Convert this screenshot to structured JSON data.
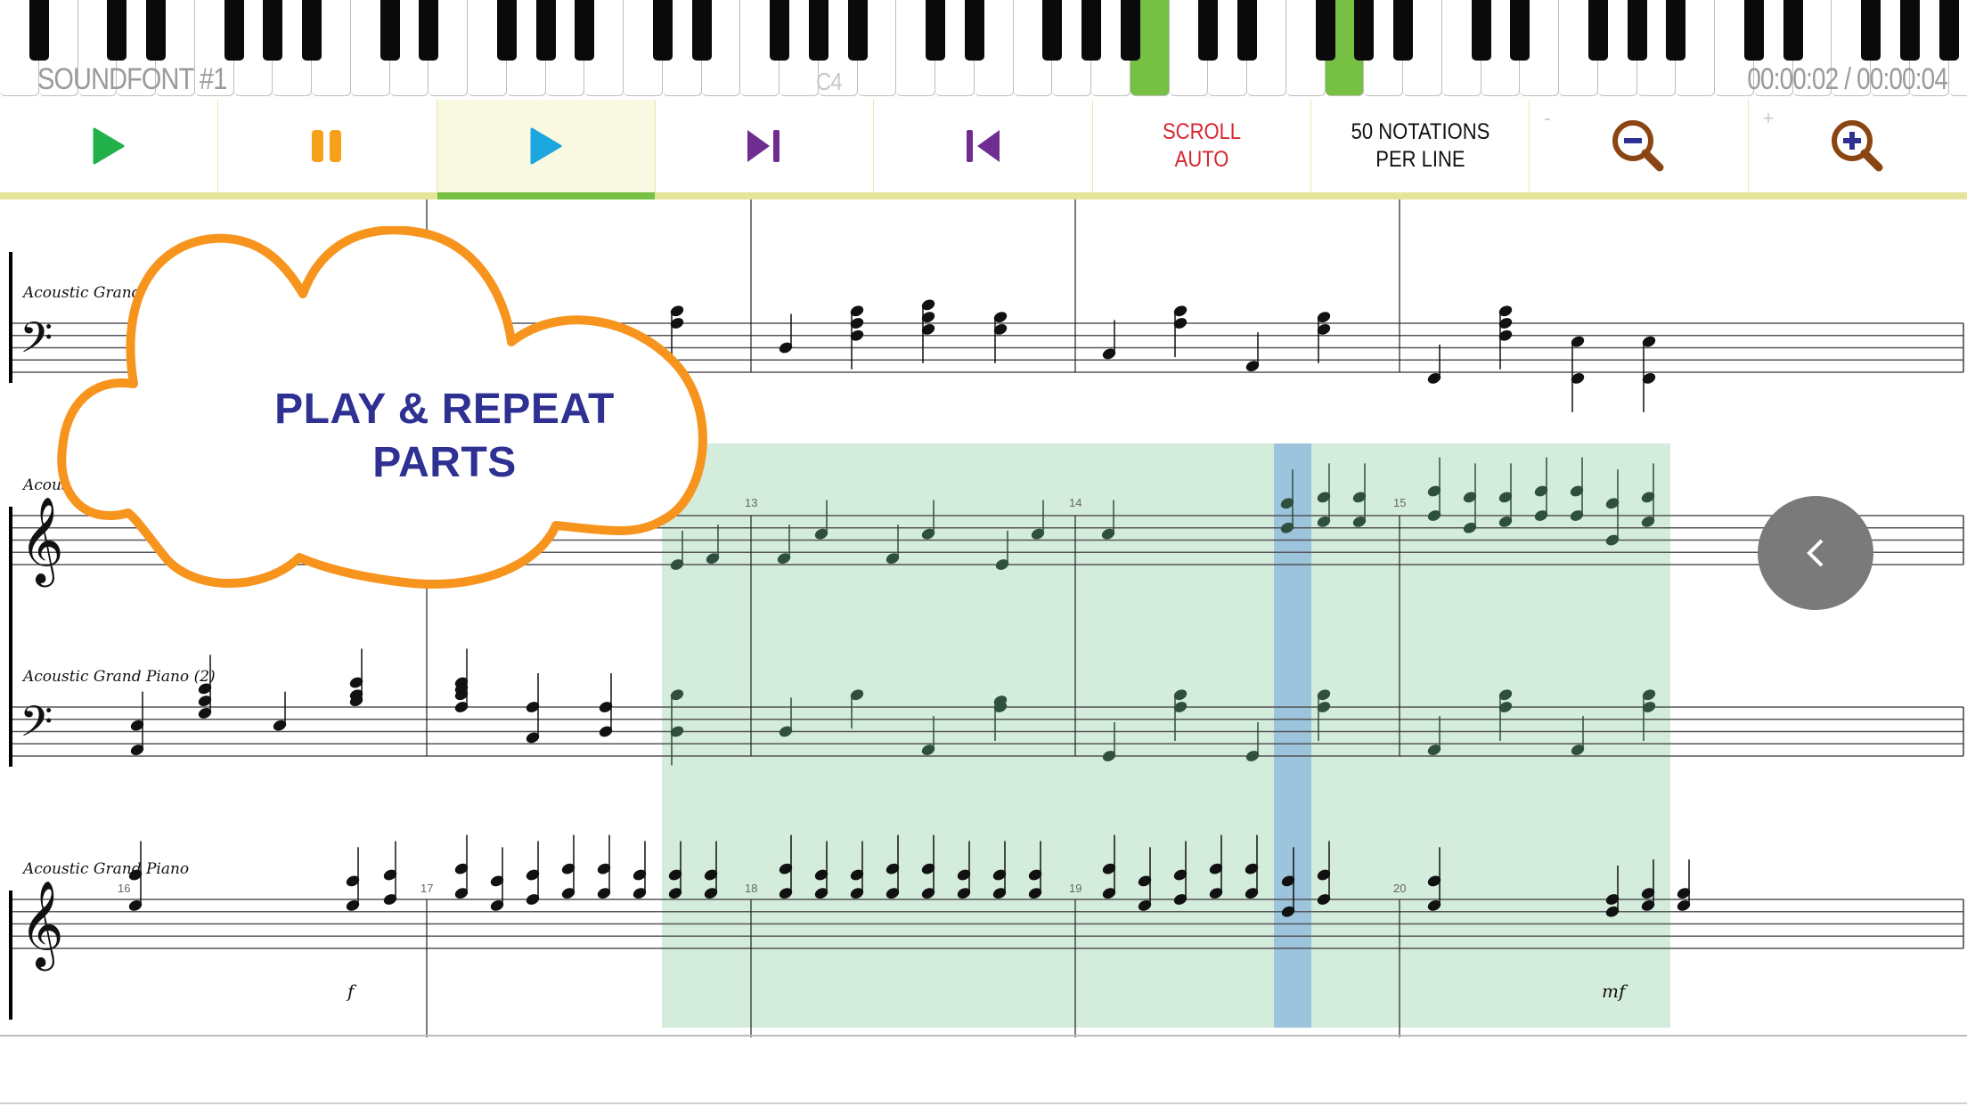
{
  "keyboard": {
    "soundfont_label": "SOUNDFONT #1",
    "octave_marker": "C4",
    "time_display": "00:00:02 / 00:00:04",
    "active_key_indices": [
      29,
      34
    ],
    "active_key_color": "#76c043"
  },
  "toolbar": {
    "buttons": [
      {
        "name": "play-button",
        "icon": "play-icon",
        "color": "#22b04b"
      },
      {
        "name": "pause-button",
        "icon": "pause-icon",
        "color": "#f7a11a"
      },
      {
        "name": "play-selection-button",
        "icon": "play-icon",
        "color": "#1ba6df",
        "active": true
      },
      {
        "name": "skip-forward-button",
        "icon": "skip-next-icon",
        "color": "#6f2c91"
      },
      {
        "name": "skip-back-button",
        "icon": "skip-previous-icon",
        "color": "#6f2c91"
      },
      {
        "name": "scroll-mode-button",
        "label_line1": "SCROLL",
        "label_line2": "AUTO",
        "color": "#d7262f"
      },
      {
        "name": "notations-per-line-button",
        "label_line1": "50 NOTATIONS",
        "label_line2": "PER LINE",
        "color": "#111111"
      },
      {
        "name": "zoom-out-button",
        "icon": "zoom-out-icon",
        "hint": "-",
        "color": "#8b4513"
      },
      {
        "name": "zoom-in-button",
        "icon": "zoom-in-icon",
        "hint": "+",
        "color": "#8b4513"
      }
    ],
    "accent_bar_color": "#e6e39a",
    "active_indicator_color": "#76c043"
  },
  "callout": {
    "line1": "PLAY & REPEAT",
    "line2": "PARTS",
    "text_color": "#2e3192",
    "border_color": "#f7941d"
  },
  "score": {
    "systems": [
      {
        "staves": [
          {
            "label": "Acoustic Grand P",
            "clef": "bass"
          }
        ],
        "measure_numbers": []
      },
      {
        "staves": [
          {
            "label": "Acous",
            "clef": "treble"
          },
          {
            "label": "Acoustic Grand Piano (2)",
            "clef": "bass"
          }
        ],
        "measure_numbers": [
          "13",
          "14",
          "15"
        ]
      },
      {
        "staves": [
          {
            "label": "Acoustic Grand Piano",
            "clef": "treble"
          }
        ],
        "measure_numbers": [
          "16",
          "17",
          "18",
          "19",
          "20"
        ],
        "dynamics": [
          "f",
          "mf"
        ]
      }
    ],
    "selection": {
      "start_measure": "12",
      "end_measure": "15",
      "color": "#d4ecdc"
    },
    "playhead_color": "#9cc4dc"
  },
  "nav_button": {
    "icon": "chevron-left-icon"
  }
}
